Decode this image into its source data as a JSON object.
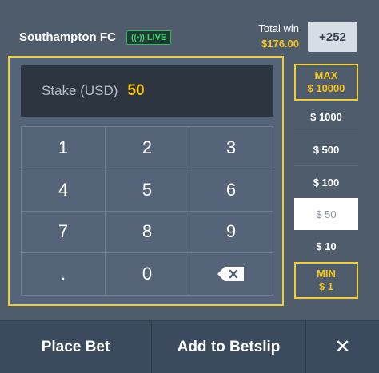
{
  "header": {
    "team": "Southampton FC",
    "live_label": "LIVE",
    "total_win_label": "Total win",
    "total_win_amount": "$176.00",
    "odds": "+252"
  },
  "stake": {
    "label": "Stake (USD)",
    "value": "50"
  },
  "keypad": {
    "keys": [
      "1",
      "2",
      "3",
      "4",
      "5",
      "6",
      "7",
      "8",
      "9",
      ".",
      "0"
    ],
    "backspace_icon": "backspace-icon"
  },
  "amounts": {
    "max_label": "MAX",
    "max_value": "$ 10000",
    "items": [
      "$ 1000",
      "$ 500",
      "$ 100",
      "$ 50",
      "$ 10"
    ],
    "selected": "$ 50",
    "min_label": "MIN",
    "min_value": "$ 1"
  },
  "footer": {
    "place_bet": "Place Bet",
    "add_to_betslip": "Add to Betslip",
    "close": "✕"
  },
  "colors": {
    "accent_yellow": "#f5c518",
    "live_green": "#39d36a",
    "background": "#4f5c6c"
  }
}
